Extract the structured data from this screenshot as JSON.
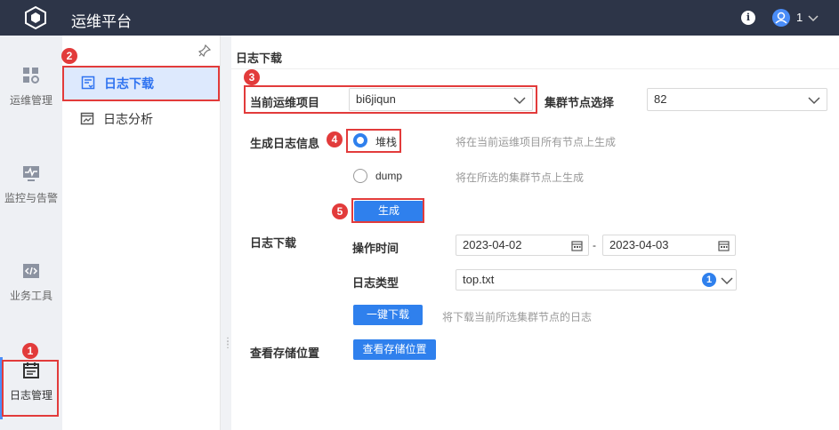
{
  "app": {
    "title": "运维平台",
    "user_name": "1"
  },
  "left_nav": [
    {
      "label": "运维管理"
    },
    {
      "label": "监控与告警"
    },
    {
      "label": "业务工具"
    },
    {
      "label": "日志管理"
    }
  ],
  "sub_nav": [
    {
      "label": "日志下载"
    },
    {
      "label": "日志分析"
    }
  ],
  "page": {
    "title": "日志下载"
  },
  "form": {
    "project_label": "当前运维项目",
    "project_value": "bi6jiqun",
    "cluster_label": "集群节点选择",
    "cluster_value": "82",
    "generate_label": "生成日志信息",
    "option_stack": "堆栈",
    "option_stack_hint": "将在当前运维项目所有节点上生成",
    "option_dump": "dump",
    "option_dump_hint": "将在所选的集群节点上生成",
    "generate_button": "生成",
    "download_label": "日志下载",
    "time_label": "操作时间",
    "date_from": "2023-04-02",
    "date_sep": "-",
    "date_to": "2023-04-03",
    "type_label": "日志类型",
    "type_value": "top.txt",
    "type_count": "1",
    "download_button": "一键下载",
    "download_hint": "将下载当前所选集群节点的日志",
    "storage_label": "查看存储位置",
    "storage_button": "查看存储位置"
  },
  "annotations": [
    "1",
    "2",
    "3",
    "4",
    "5"
  ],
  "colors": {
    "accent": "#2f80ed",
    "topbar": "#2d3548",
    "highlight": "#e23b3b",
    "active_bg": "#dde9fd"
  }
}
